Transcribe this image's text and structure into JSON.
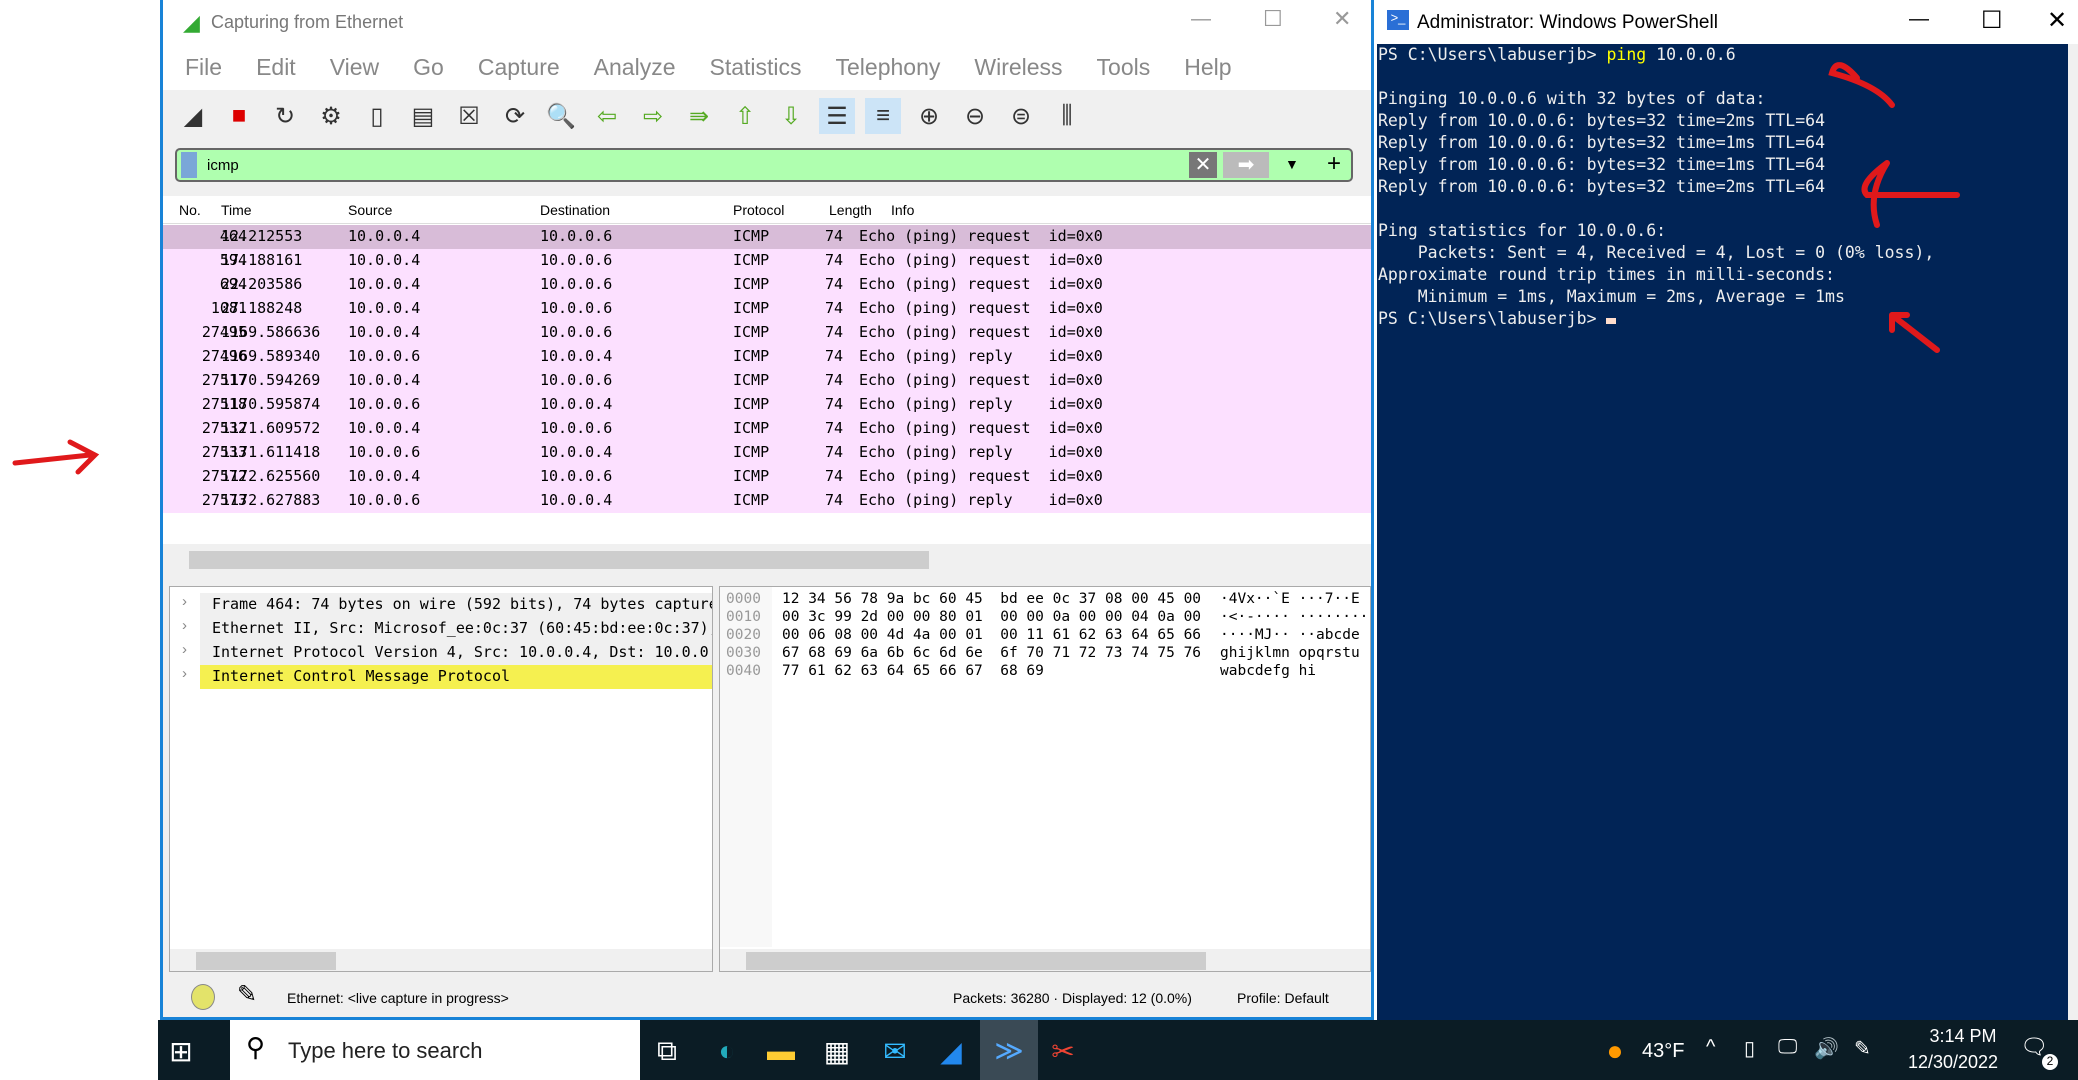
{
  "wireshark": {
    "title": "Capturing from Ethernet",
    "menu": [
      "File",
      "Edit",
      "View",
      "Go",
      "Capture",
      "Analyze",
      "Statistics",
      "Telephony",
      "Wireless",
      "Tools",
      "Help"
    ],
    "toolbar_icons": [
      "shark-fin-start-icon",
      "stop-capture-icon",
      "restart-capture-icon",
      "capture-options-icon",
      "open-file-icon",
      "save-file-icon",
      "close-file-icon",
      "reload-file-icon",
      "find-packet-icon",
      "go-back-icon",
      "go-forward-icon",
      "go-to-packet-icon",
      "first-packet-icon",
      "last-packet-icon",
      "autoscroll-icon",
      "colorize-icon",
      "zoom-in-icon",
      "zoom-out-icon",
      "normal-size-icon",
      "resize-columns-icon"
    ],
    "filter": {
      "value": "icmp",
      "bg": "#afffaf"
    },
    "columns": [
      "No.",
      "Time",
      "Source",
      "Destination",
      "Protocol",
      "Length",
      "Info"
    ],
    "packets": [
      [
        "464",
        "12.212553",
        "10.0.0.4",
        "10.0.0.6",
        "ICMP",
        "74",
        "Echo (ping) request  id=0x0"
      ],
      [
        "594",
        "17.188161",
        "10.0.0.4",
        "10.0.0.6",
        "ICMP",
        "74",
        "Echo (ping) request  id=0x0"
      ],
      [
        "694",
        "22.203586",
        "10.0.0.4",
        "10.0.0.6",
        "ICMP",
        "74",
        "Echo (ping) request  id=0x0"
      ],
      [
        "1081",
        "27.188248",
        "10.0.0.4",
        "10.0.0.6",
        "ICMP",
        "74",
        "Echo (ping) request  id=0x0"
      ],
      [
        "27495",
        "1169.586636",
        "10.0.0.4",
        "10.0.0.6",
        "ICMP",
        "74",
        "Echo (ping) request  id=0x0"
      ],
      [
        "27496",
        "1169.589340",
        "10.0.0.6",
        "10.0.0.4",
        "ICMP",
        "74",
        "Echo (ping) reply    id=0x0"
      ],
      [
        "27517",
        "1170.594269",
        "10.0.0.4",
        "10.0.0.6",
        "ICMP",
        "74",
        "Echo (ping) request  id=0x0"
      ],
      [
        "27518",
        "1170.595874",
        "10.0.0.6",
        "10.0.0.4",
        "ICMP",
        "74",
        "Echo (ping) reply    id=0x0"
      ],
      [
        "27532",
        "1171.609572",
        "10.0.0.4",
        "10.0.0.6",
        "ICMP",
        "74",
        "Echo (ping) request  id=0x0"
      ],
      [
        "27533",
        "1171.611418",
        "10.0.0.6",
        "10.0.0.4",
        "ICMP",
        "74",
        "Echo (ping) reply    id=0x0"
      ],
      [
        "27572",
        "1172.625560",
        "10.0.0.4",
        "10.0.0.6",
        "ICMP",
        "74",
        "Echo (ping) request  id=0x0"
      ],
      [
        "27573",
        "1172.627883",
        "10.0.0.6",
        "10.0.0.4",
        "ICMP",
        "74",
        "Echo (ping) reply    id=0x0"
      ]
    ],
    "row_colors": {
      "selected": "#d8bcd8",
      "icmp": "#fce0ff"
    },
    "details": [
      "Frame 464: 74 bytes on wire (592 bits), 74 bytes capture",
      "Ethernet II, Src: Microsof_ee:0c:37 (60:45:bd:ee:0c:37),",
      "Internet Protocol Version 4, Src: 10.0.0.4, Dst: 10.0.0.",
      "Internet Control Message Protocol"
    ],
    "hex": [
      [
        "0000",
        "12 34 56 78 9a bc 60 45  bd ee 0c 37 08 00 45 00",
        "·4Vx··`E ···7··E"
      ],
      [
        "0010",
        "00 3c 99 2d 00 00 80 01  00 00 0a 00 00 04 0a 00",
        "·<·-···· ········"
      ],
      [
        "0020",
        "00 06 08 00 4d 4a 00 01  00 11 61 62 63 64 65 66",
        "····MJ·· ··abcde"
      ],
      [
        "0030",
        "67 68 69 6a 6b 6c 6d 6e  6f 70 71 72 73 74 75 76",
        "ghijklmn opqrstu"
      ],
      [
        "0040",
        "77 61 62 63 64 65 66 67  68 69",
        "wabcdefg hi"
      ]
    ],
    "status": {
      "interface": "Ethernet: <live capture in progress>",
      "packets": "Packets: 36280 · Displayed: 12 (0.0%)",
      "profile": "Profile: Default"
    }
  },
  "powershell": {
    "title": "Administrator: Windows PowerShell",
    "prompt": "PS C:\\Users\\labuserjb> ",
    "command": "ping",
    "command_args": " 10.0.0.6",
    "output": [
      "",
      "Pinging 10.0.0.6 with 32 bytes of data:",
      "Reply from 10.0.0.6: bytes=32 time=2ms TTL=64",
      "Reply from 10.0.0.6: bytes=32 time=1ms TTL=64",
      "Reply from 10.0.0.6: bytes=32 time=1ms TTL=64",
      "Reply from 10.0.0.6: bytes=32 time=2ms TTL=64",
      "",
      "Ping statistics for 10.0.0.6:",
      "    Packets: Sent = 4, Received = 4, Lost = 0 (0% loss),",
      "Approximate round trip times in milli-seconds:",
      "    Minimum = 1ms, Maximum = 2ms, Average = 1ms"
    ],
    "final_prompt": "PS C:\\Users\\labuserjb> "
  },
  "taskbar": {
    "search_placeholder": "Type here to search",
    "weather": "43°F",
    "time": "3:14 PM",
    "date": "12/30/2022",
    "notifications": "2"
  }
}
